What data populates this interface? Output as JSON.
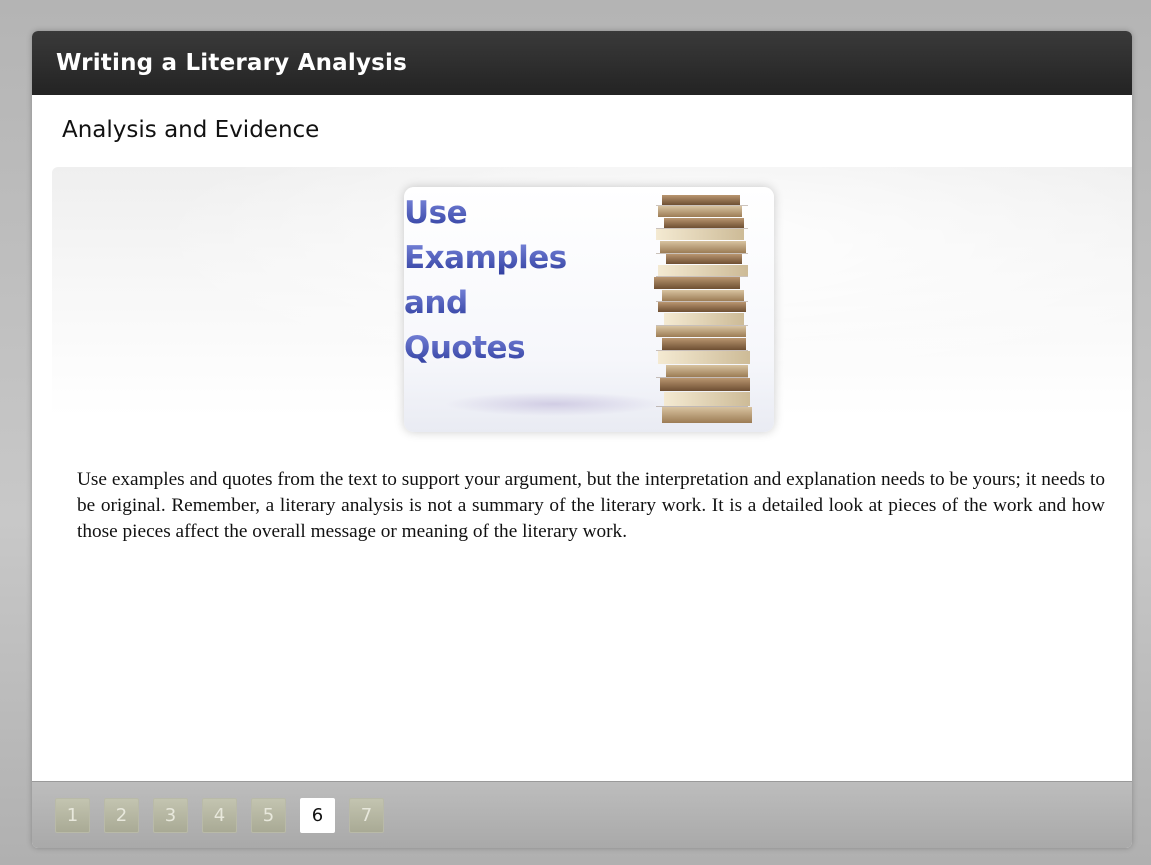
{
  "window": {
    "title": "Writing a Literary Analysis"
  },
  "slide": {
    "heading": "Analysis and Evidence",
    "image": {
      "lines": [
        "Use",
        "Examples",
        "and",
        "Quotes"
      ],
      "icon": "book-stack-icon"
    },
    "body": "Use examples and quotes from the text to support your argument, but the interpretation and explanation needs to be yours; it needs to be original. Remember, a literary analysis is not a summary of the literary work. It is a detailed look at pieces of the work and how those pieces affect the overall message or meaning of the literary work."
  },
  "pagination": {
    "pages": [
      "1",
      "2",
      "3",
      "4",
      "5",
      "6",
      "7"
    ],
    "current": "6"
  },
  "colors": {
    "titlebar": "#2b2b2b",
    "accent_text": "#3f4fb8",
    "footer": "#b3b3b3"
  }
}
